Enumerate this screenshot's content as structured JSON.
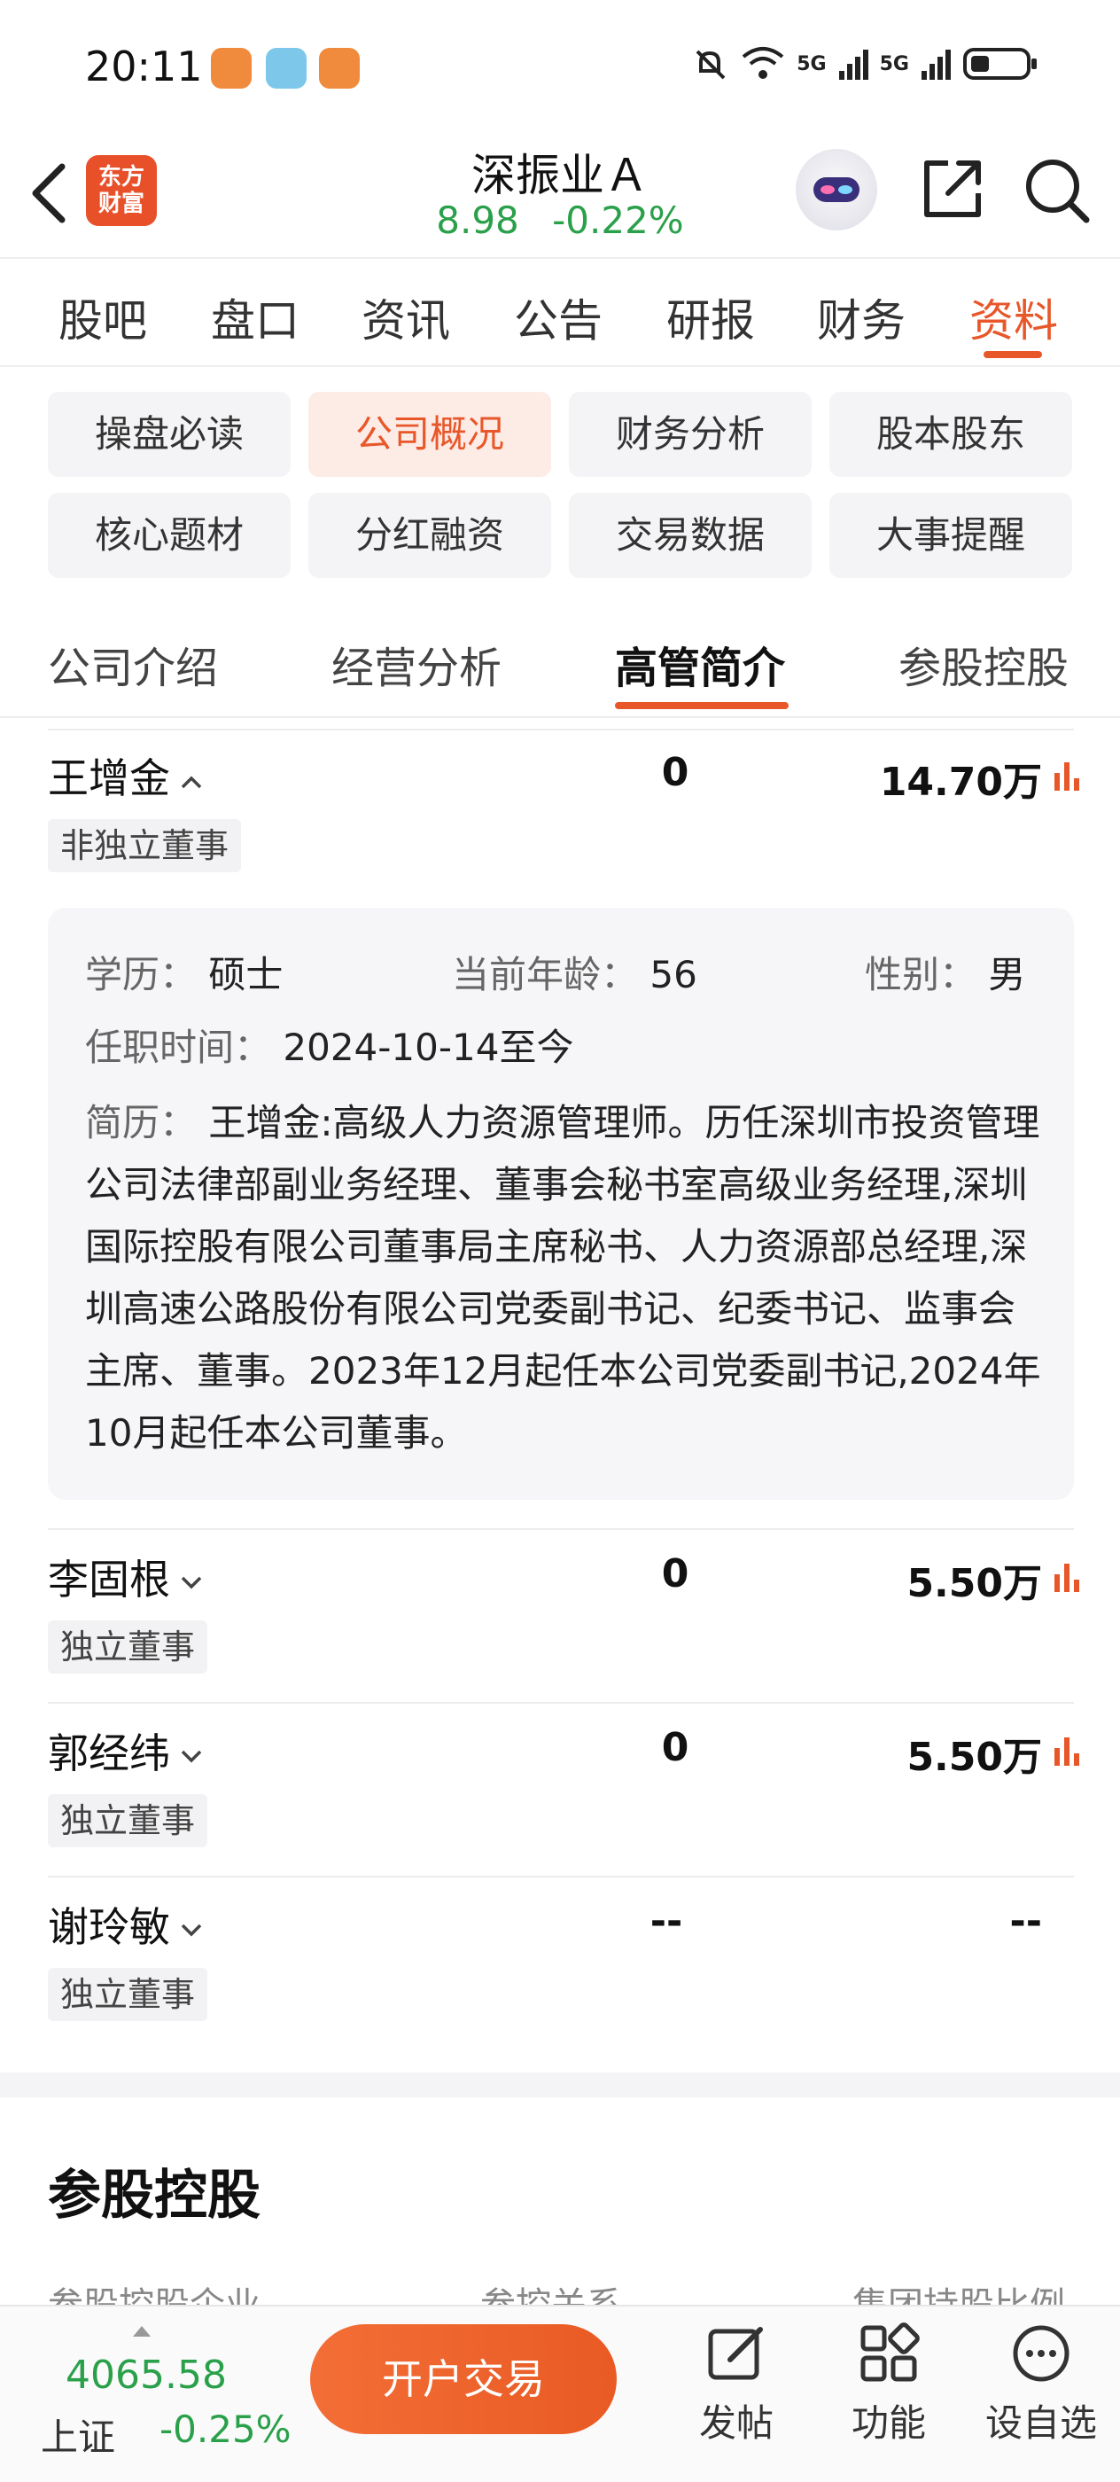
{
  "status_bar": {
    "time": "20:11",
    "network_1": "5G",
    "network_2": "5G"
  },
  "header": {
    "logo_text_line1": "东方",
    "logo_text_line2": "财富",
    "stock_name": "深振业Ａ",
    "price": "8.98",
    "change_pct": "-0.22%"
  },
  "main_tabs": [
    "股吧",
    "盘口",
    "资讯",
    "公告",
    "研报",
    "财务",
    "资料"
  ],
  "main_tab_active": "资料",
  "sub_chips": [
    "操盘必读",
    "公司概况",
    "财务分析",
    "股本股东",
    "核心题材",
    "分红融资",
    "交易数据",
    "大事提醒"
  ],
  "sub_chip_active": "公司概况",
  "section_tabs": [
    "公司介绍",
    "经营分析",
    "高管简介",
    "参股控股"
  ],
  "section_tab_active": "高管简介",
  "executives": [
    {
      "name": "王增金",
      "expanded": true,
      "shares": "0",
      "salary": "14.70万",
      "role": "非独立董事"
    },
    {
      "name": "李固根",
      "expanded": false,
      "shares": "0",
      "salary": "5.50万",
      "role": "独立董事"
    },
    {
      "name": "郭经纬",
      "expanded": false,
      "shares": "0",
      "salary": "5.50万",
      "role": "独立董事"
    },
    {
      "name": "谢玲敏",
      "expanded": false,
      "shares": "--",
      "salary": "--",
      "role": "独立董事"
    }
  ],
  "detail": {
    "education_label": "学历：",
    "education": "硕士",
    "age_label": "当前年龄：",
    "age": "56",
    "gender_label": "性别：",
    "gender": "男",
    "tenure_label": "任职时间：",
    "tenure": "2024-10-14至今",
    "bio_label": "简历：",
    "bio": "王增金:高级人力资源管理师。历任深圳市投资管理公司法律部副业务经理、董事会秘书室高级业务经理,深圳国际控股有限公司董事局主席秘书、人力资源部总经理,深圳高速公路股份有限公司党委副书记、纪委书记、监事会主席、董事。2023年12月起任本公司党委副书记,2024年10月起任本公司董事。"
  },
  "holdings_section": {
    "title": "参股控股",
    "columns": [
      "参股控股企业",
      "参控关系",
      "集团持股比例"
    ]
  },
  "bottom_bar": {
    "index_value": "4065.58",
    "index_name": "上证",
    "index_change": "-0.25%",
    "open_account": "开户交易",
    "nav": [
      "发帖",
      "功能",
      "设自选"
    ]
  },
  "colors": {
    "accent": "#e8572a",
    "down_green": "#2aa04a"
  }
}
